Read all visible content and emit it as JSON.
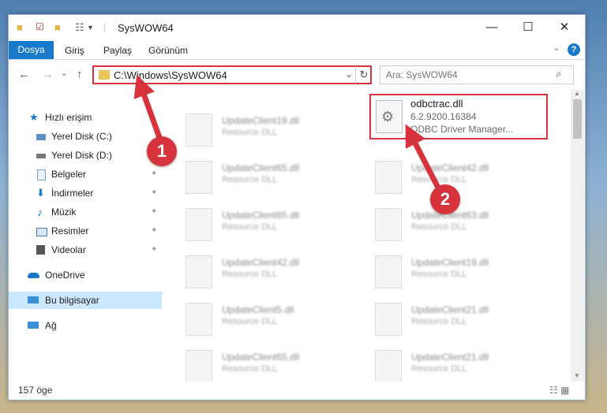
{
  "window": {
    "title": "SysWOW64",
    "minimize_glyph": "—",
    "maximize_glyph": "☐",
    "close_glyph": "✕"
  },
  "quick_access_toolbar": {
    "icons": [
      "folder-icon",
      "properties-icon",
      "new-folder-icon",
      "customize-icon"
    ],
    "dropdown_glyph": "▾"
  },
  "ribbon": {
    "tabs": [
      {
        "label": "Dosya",
        "active": true
      },
      {
        "label": "Giriş"
      },
      {
        "label": "Paylaş"
      },
      {
        "label": "Görünüm"
      }
    ],
    "help_glyph": "?",
    "expand_glyph": "⌄"
  },
  "navigation": {
    "back_glyph": "←",
    "forward_glyph": "→",
    "recent_glyph": "⌄",
    "up_glyph": "↑",
    "address_path": "C:\\Windows\\SysWOW64",
    "address_dropdown_glyph": "⌄",
    "refresh_glyph": "↻",
    "search_placeholder": "Ara: SysWOW64",
    "search_glyph": "⌕"
  },
  "sidebar": {
    "items": [
      {
        "label": "Hızlı erişim",
        "icon": "star-icon",
        "color": "#1979ca"
      },
      {
        "label": "Yerel Disk (C:)",
        "icon": "drive-icon",
        "color": "#5a8fbf"
      },
      {
        "label": "Yerel Disk (D:)",
        "icon": "drive-icon",
        "color": "#777777"
      },
      {
        "label": "Belgeler",
        "icon": "documents-icon",
        "color": "#7a9cc6",
        "pinned": true
      },
      {
        "label": "İndirmeler",
        "icon": "downloads-icon",
        "color": "#1979ca",
        "pinned": true
      },
      {
        "label": "Müzik",
        "icon": "music-icon",
        "color": "#1979ca",
        "pinned": true
      },
      {
        "label": "Resimler",
        "icon": "pictures-icon",
        "color": "#4a7fb0",
        "pinned": true
      },
      {
        "label": "Videolar",
        "icon": "videos-icon",
        "color": "#555555",
        "pinned": true
      },
      {
        "label": "OneDrive",
        "icon": "cloud-icon",
        "color": "#1979ca"
      },
      {
        "label": "Bu bilgisayar",
        "icon": "computer-icon",
        "color": "#3b8fd9",
        "selected": true
      },
      {
        "label": "Ağ",
        "icon": "network-icon",
        "color": "#3b8fd9"
      }
    ],
    "pin_glyph": "📌"
  },
  "files": [
    {
      "name": "UpdateClient19.dll",
      "type": "Resource DLL"
    },
    {
      "name": "UpdateClient65.dll",
      "type": "Resource DLL"
    },
    {
      "name": "UpdateClient42.dll",
      "type": "Resource DLL"
    },
    {
      "name": "UpdateClient65.dll",
      "type": "Resource DLL"
    },
    {
      "name": "UpdateClient63.dll",
      "type": "Resource DLL"
    },
    {
      "name": "UpdateClient42.dll",
      "type": "Resource DLL"
    },
    {
      "name": "UpdateClient19.dll",
      "type": "Resource DLL"
    },
    {
      "name": "UpdateClient5.dll",
      "type": "Resource DLL"
    },
    {
      "name": "UpdateClient21.dll",
      "type": "Resource DLL"
    },
    {
      "name": "UpdateClient65.dll",
      "type": "Resource DLL"
    },
    {
      "name": "UpdateClient21.dll",
      "type": "Resource DLL"
    }
  ],
  "highlighted_file": {
    "name": "odbctrac.dll",
    "version": "6.2.9200.16384",
    "description": "ODBC Driver Manager...",
    "icon": "dll-gear-icon"
  },
  "status_bar": {
    "item_count": "157 öge",
    "view_glyphs": "☷ ▦"
  },
  "annotations": {
    "badge_1": "1",
    "badge_2": "2",
    "color": "#d6333c"
  }
}
